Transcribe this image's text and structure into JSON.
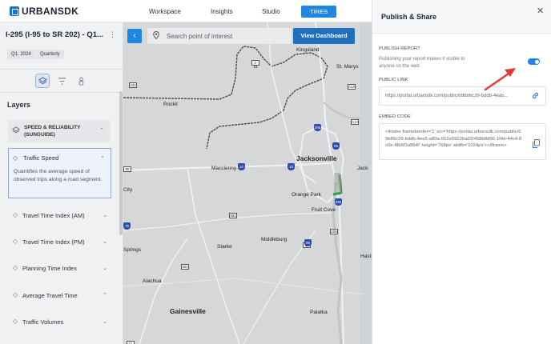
{
  "topnav": {
    "brand": "URBANSDK",
    "items": [
      "Workspace",
      "Insights",
      "Studio"
    ],
    "active_button": "TIRES"
  },
  "leftpanel": {
    "report_title": "I-295 (I-95 to SR 202) - Q1...",
    "chips": [
      "Q1, 2024",
      "Quarterly"
    ],
    "layers_heading": "Layers",
    "group": {
      "title": "SPEED & RELIABILITY (SUNGUIDE)"
    },
    "active_layer": {
      "title": "Traffic Speed",
      "description": "Quantifies the average speed of observed trips along a road segment."
    },
    "layers": [
      "Travel Time Index (AM)",
      "Travel Time Index (PM)",
      "Planning Time Index",
      "Average Travel Time",
      "Traffic Volumes"
    ]
  },
  "map": {
    "search_placeholder": "Search point of interest",
    "view_dashboard": "View Dashboard",
    "places": [
      {
        "name": "Kingsland",
        "big": false
      },
      {
        "name": "St. Marys",
        "big": false
      },
      {
        "name": "Rockil",
        "big": false
      },
      {
        "name": "Jacksonville",
        "big": true
      },
      {
        "name": "Jacksonville Beach",
        "big": false
      },
      {
        "name": "Macclenny",
        "big": false
      },
      {
        "name": "Orange Park",
        "big": false
      },
      {
        "name": "Fruit Cove",
        "big": false
      },
      {
        "name": "City",
        "big": false
      },
      {
        "name": "Middleburg",
        "big": false
      },
      {
        "name": "Starke",
        "big": false
      },
      {
        "name": "Springs",
        "big": false
      },
      {
        "name": "Alachua",
        "big": false
      },
      {
        "name": "Gainesville",
        "big": true
      },
      {
        "name": "Palatka",
        "big": false
      },
      {
        "name": "Hastings",
        "big": false
      }
    ],
    "shields": [
      "1-23",
      "A1A",
      "A1A",
      "441",
      "381",
      "90",
      "16",
      "206",
      "301",
      "21"
    ],
    "interstates": [
      "295",
      "95",
      "10",
      "10",
      "295",
      "75",
      "95"
    ]
  },
  "modal": {
    "title": "Publish & Share",
    "publish_label": "PUBLISH REPORT",
    "publish_desc": "Publishing your report makes it visible to anyone on the web",
    "public_link_label": "PUBLIC LINK",
    "public_link_value": "https://portal.urbansdk.com/public/69b86c39-bddb-4ea5...",
    "embed_label": "EMBED CODE",
    "embed_value": "<iframe frameborder='1' src='https://portal.urbansdk.com/public/69b86c39-bddb-4ea5-a80a-552e5922ba03/458b8d56-1f4d-44c4-8c0e-f8b6f3a864f' height='768px' width='1024px'></iframe>"
  },
  "colors": {
    "accent": "#1f87e0",
    "annotation_arrow": "#e53935"
  }
}
